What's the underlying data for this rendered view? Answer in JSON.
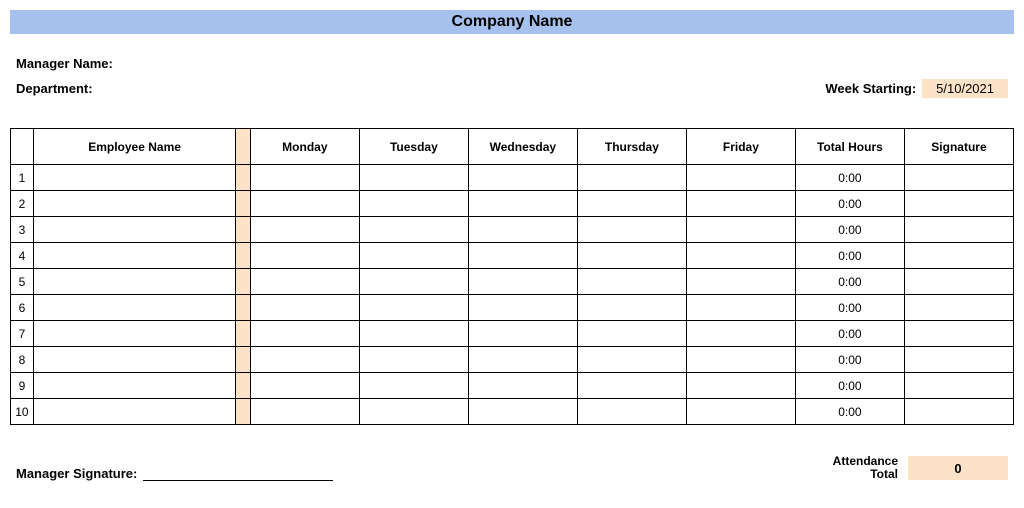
{
  "title": "Company Name",
  "labels": {
    "manager_name": "Manager Name:",
    "department": "Department:",
    "week_starting": "Week Starting:",
    "manager_signature": "Manager Signature:",
    "attendance_total": "Attendance",
    "attendance_total2": "Total"
  },
  "week_starting_value": "5/10/2021",
  "columns": {
    "employee_name": "Employee Name",
    "monday": "Monday",
    "tuesday": "Tuesday",
    "wednesday": "Wednesday",
    "thursday": "Thursday",
    "friday": "Friday",
    "total_hours": "Total Hours",
    "signature": "Signature"
  },
  "rows": [
    {
      "idx": "1",
      "employee": "",
      "mon": "",
      "tue": "",
      "wed": "",
      "thu": "",
      "fri": "",
      "total": "0:00",
      "sig": ""
    },
    {
      "idx": "2",
      "employee": "",
      "mon": "",
      "tue": "",
      "wed": "",
      "thu": "",
      "fri": "",
      "total": "0:00",
      "sig": ""
    },
    {
      "idx": "3",
      "employee": "",
      "mon": "",
      "tue": "",
      "wed": "",
      "thu": "",
      "fri": "",
      "total": "0:00",
      "sig": ""
    },
    {
      "idx": "4",
      "employee": "",
      "mon": "",
      "tue": "",
      "wed": "",
      "thu": "",
      "fri": "",
      "total": "0:00",
      "sig": ""
    },
    {
      "idx": "5",
      "employee": "",
      "mon": "",
      "tue": "",
      "wed": "",
      "thu": "",
      "fri": "",
      "total": "0:00",
      "sig": ""
    },
    {
      "idx": "6",
      "employee": "",
      "mon": "",
      "tue": "",
      "wed": "",
      "thu": "",
      "fri": "",
      "total": "0:00",
      "sig": ""
    },
    {
      "idx": "7",
      "employee": "",
      "mon": "",
      "tue": "",
      "wed": "",
      "thu": "",
      "fri": "",
      "total": "0:00",
      "sig": ""
    },
    {
      "idx": "8",
      "employee": "",
      "mon": "",
      "tue": "",
      "wed": "",
      "thu": "",
      "fri": "",
      "total": "0:00",
      "sig": ""
    },
    {
      "idx": "9",
      "employee": "",
      "mon": "",
      "tue": "",
      "wed": "",
      "thu": "",
      "fri": "",
      "total": "0:00",
      "sig": ""
    },
    {
      "idx": "10",
      "employee": "",
      "mon": "",
      "tue": "",
      "wed": "",
      "thu": "",
      "fri": "",
      "total": "0:00",
      "sig": ""
    }
  ],
  "attendance_total_value": "0"
}
